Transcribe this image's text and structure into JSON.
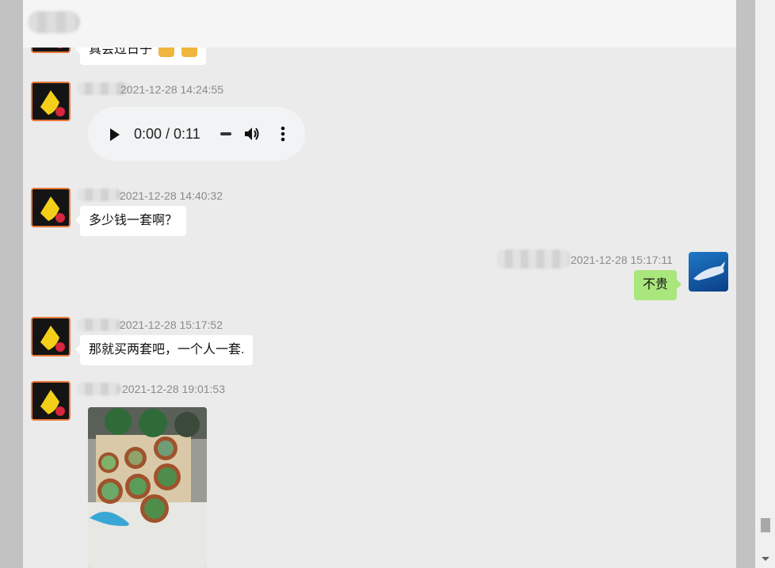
{
  "header": {
    "title": ""
  },
  "messages": [
    {
      "side": "left",
      "type": "text",
      "text": "真会过日子",
      "emoji_count": 2
    },
    {
      "side": "left",
      "type": "audio",
      "time": "2021-12-28 14:24:55",
      "audio_time": "0:00 / 0:11"
    },
    {
      "side": "left",
      "type": "text",
      "time": "2021-12-28 14:40:32",
      "text": "多少钱一套啊？"
    },
    {
      "side": "right",
      "type": "text",
      "time": "2021-12-28 15:17:11",
      "text": "不贵"
    },
    {
      "side": "left",
      "type": "text",
      "time": "2021-12-28 15:17:52",
      "text": "那就买两套吧，一个人一套."
    },
    {
      "side": "left",
      "type": "image",
      "time": "2021-12-28 19:01:53",
      "image_desc": "photo of potted succulents"
    }
  ],
  "icons": {
    "play": "play-icon",
    "volume": "volume-icon",
    "more": "more-vert-icon",
    "thumbs_up": "thumbs-up-icon"
  },
  "colors": {
    "self_bubble": "#a9e67c",
    "other_bubble": "#ffffff",
    "chat_bg": "#ebebeb",
    "header_bg": "#f5f5f5",
    "avatar_border": "#e9773b"
  }
}
